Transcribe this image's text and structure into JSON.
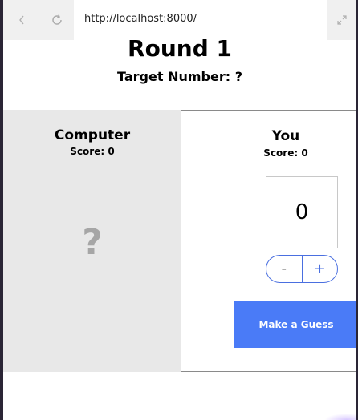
{
  "browser": {
    "url": "http://localhost:8000/"
  },
  "game": {
    "title": "Round 1",
    "target": "Target Number: ?"
  },
  "computer": {
    "name": "Computer",
    "score": "Score: 0",
    "hidden_guess": "?"
  },
  "player": {
    "name": "You",
    "score": "Score: 0",
    "guess_value": "0",
    "decrement_label": "-",
    "increment_label": "+",
    "submit_label": "Make a Guess"
  },
  "colors": {
    "accent": "#4a7bf7",
    "panel_bg": "#e8e8e8"
  }
}
